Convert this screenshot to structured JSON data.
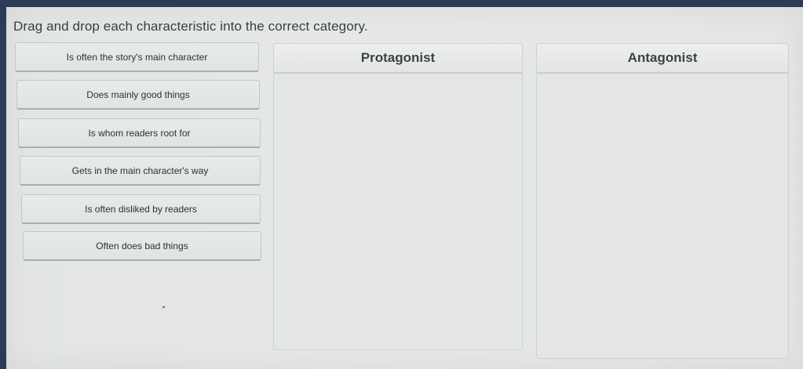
{
  "instruction": "Drag and drop each characteristic into the correct category.",
  "choices": [
    "Is often the story's main character",
    "Does mainly good things",
    "Is whom readers root for",
    "Gets in the main character's way",
    "Is often disliked by readers",
    "Often does bad things"
  ],
  "categories": [
    {
      "title": "Protagonist",
      "items": []
    },
    {
      "title": "Antagonist",
      "items": []
    }
  ]
}
